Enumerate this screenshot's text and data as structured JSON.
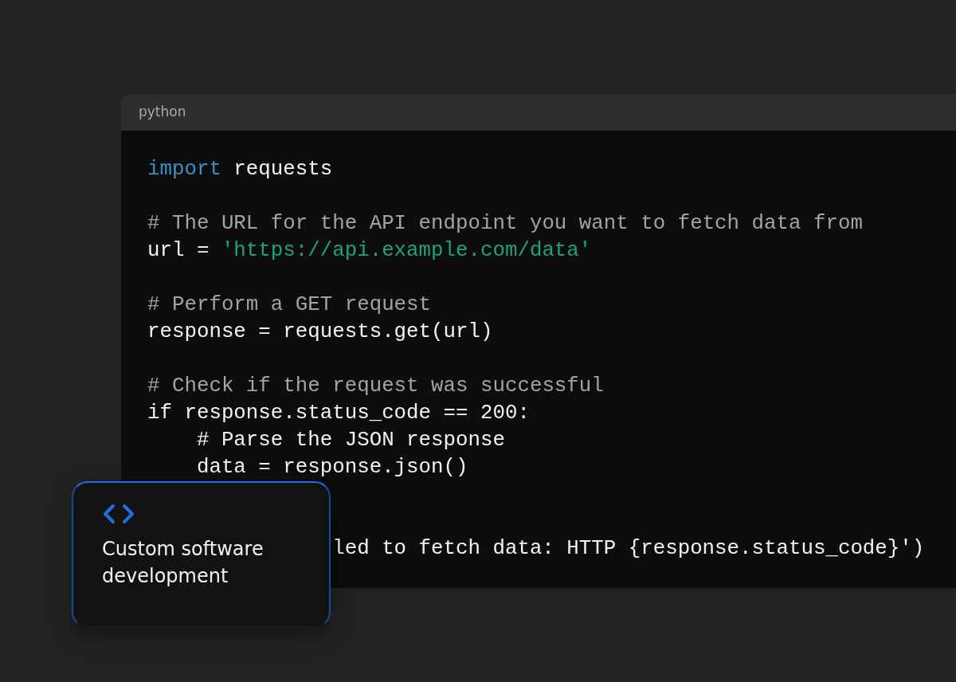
{
  "editor": {
    "language": "python",
    "lines": [
      {
        "kind": "code",
        "tokens": [
          {
            "kind": "keyword",
            "text": "import"
          },
          {
            "kind": "plain",
            "text": " requests"
          }
        ]
      },
      {
        "kind": "blank"
      },
      {
        "kind": "code",
        "tokens": [
          {
            "kind": "comment",
            "text": "# The URL for the API endpoint you want to fetch data from"
          }
        ]
      },
      {
        "kind": "code",
        "tokens": [
          {
            "kind": "plain",
            "text": "url = "
          },
          {
            "kind": "string",
            "text": "'https://api.example.com/data'"
          }
        ]
      },
      {
        "kind": "blank"
      },
      {
        "kind": "code",
        "tokens": [
          {
            "kind": "comment",
            "text": "# Perform a GET request"
          }
        ]
      },
      {
        "kind": "code",
        "tokens": [
          {
            "kind": "plain",
            "text": "response = requests.get(url)"
          }
        ]
      },
      {
        "kind": "blank"
      },
      {
        "kind": "code",
        "tokens": [
          {
            "kind": "comment",
            "text": "# Check if the request was successful"
          }
        ]
      },
      {
        "kind": "code",
        "tokens": [
          {
            "kind": "plain",
            "text": "if response.status_code == 200:"
          }
        ]
      },
      {
        "kind": "code",
        "tokens": [
          {
            "kind": "plain",
            "text": "    # Parse the JSON response"
          }
        ]
      },
      {
        "kind": "code",
        "tokens": [
          {
            "kind": "plain",
            "text": "    data = response.json()"
          }
        ]
      },
      {
        "kind": "blank"
      },
      {
        "kind": "blank"
      },
      {
        "kind": "cut",
        "tokens": [
          {
            "kind": "plain",
            "text": "led to fetch data: HTTP {response.status_code}')"
          }
        ]
      }
    ]
  },
  "card": {
    "title": "Custom software development"
  }
}
